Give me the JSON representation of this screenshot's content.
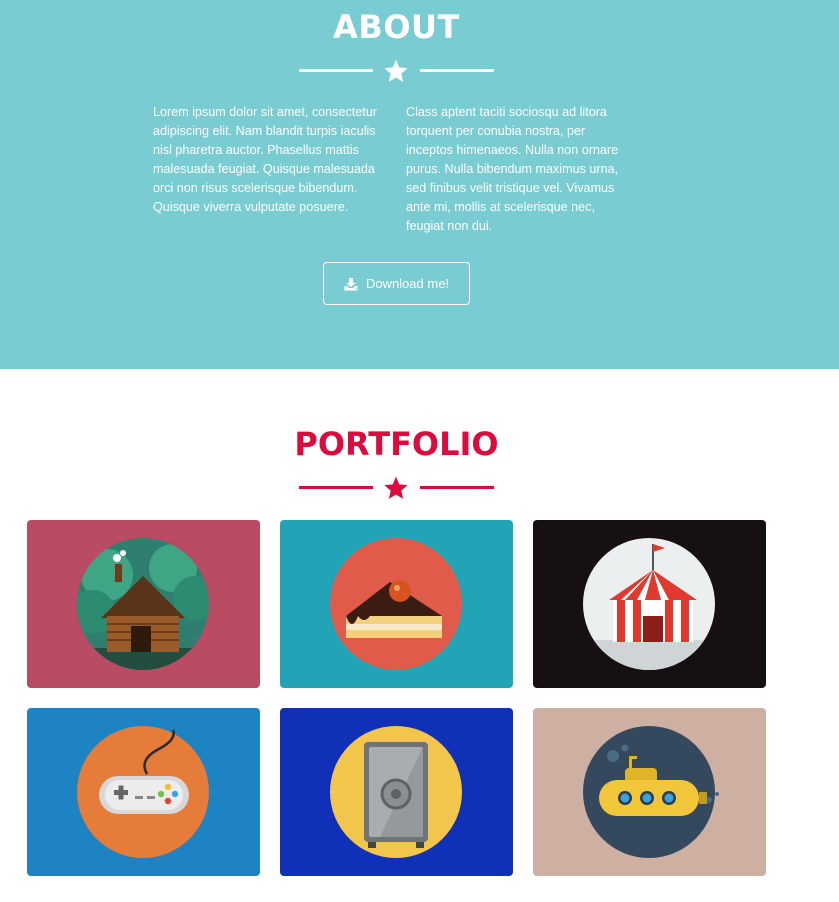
{
  "about": {
    "title": "ABOUT",
    "col_left": "Lorem ipsum dolor sit amet, consectetur adipiscing elit. Nam blandit turpis iaculis nisl pharetra auctor. Phasellus mattis malesuada feugiat. Quisque malesuada orci non risus scelerisque bibendum. Quisque viverra vulputate posuere.",
    "col_right": "Class aptent taciti sociosqu ad litora torquent per conubia nostra, per inceptos himenaeos. Nulla non ornare purus. Nulla bibendum maximus urna, sed finibus velit tristique vel. Vivamus ante mi, mollis at scelerisque nec, feugiat non dui.",
    "button_label": "Download me!",
    "button_icon": "download-icon",
    "background": "#79cdd2"
  },
  "portfolio": {
    "title": "PORTFOLIO",
    "accent": "#dc0b3e",
    "items": [
      {
        "icon": "cabin-icon",
        "background": "#b94b63"
      },
      {
        "icon": "cake-icon",
        "background": "#22a4b6"
      },
      {
        "icon": "circus-tent-icon",
        "background": "#161010"
      },
      {
        "icon": "game-controller-icon",
        "background": "#1e83c3"
      },
      {
        "icon": "safe-icon",
        "background": "#1030b7"
      },
      {
        "icon": "submarine-icon",
        "background": "#cdb0a2"
      }
    ]
  }
}
